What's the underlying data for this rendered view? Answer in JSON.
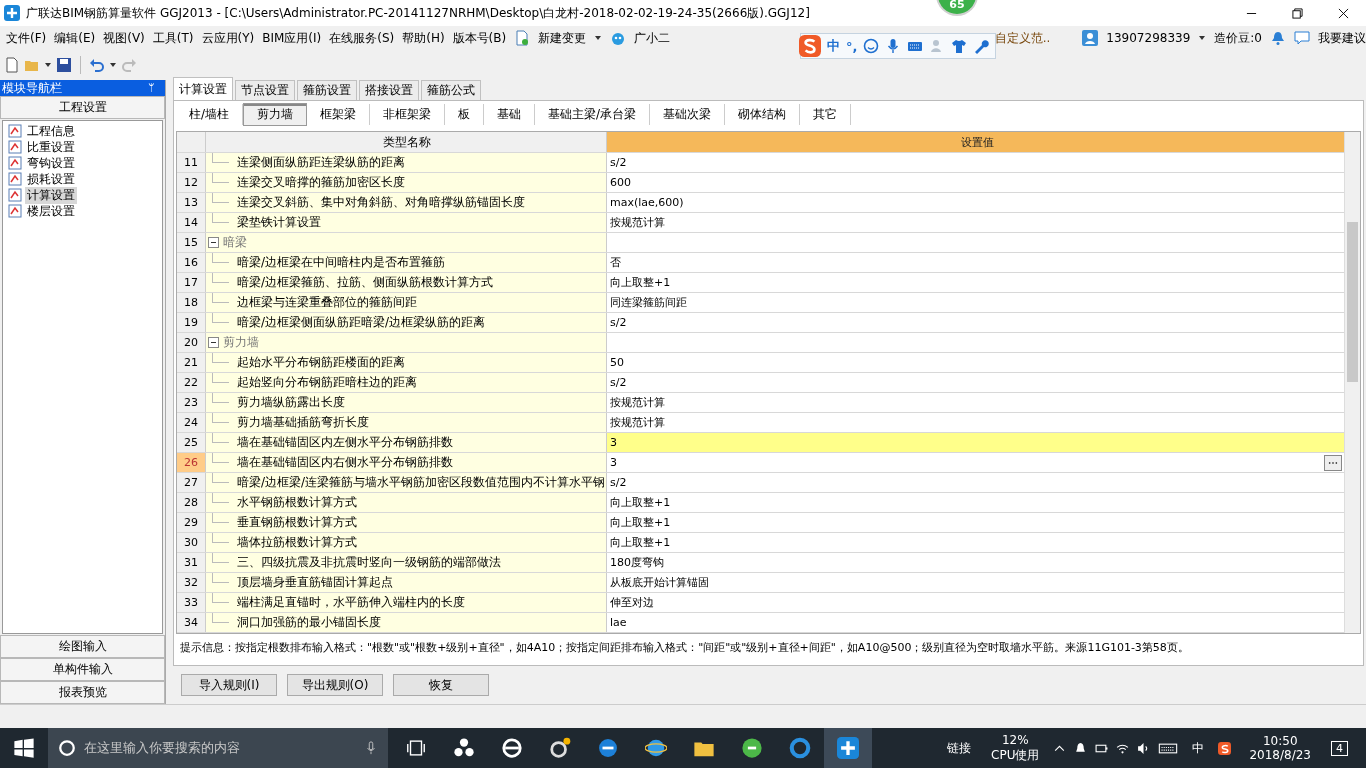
{
  "window": {
    "title": "广联达BIM钢筋算量软件 GGJ2013 - [C:\\Users\\Administrator.PC-20141127NRHM\\Desktop\\白龙村-2018-02-02-19-24-35(2666版).GGJ12]"
  },
  "badge": "65",
  "menu": [
    "文件(F)",
    "编辑(E)",
    "视图(V)",
    "工具(T)",
    "云应用(Y)",
    "BIM应用(I)",
    "在线服务(S)",
    "帮助(H)",
    "版本号(B)"
  ],
  "new_change": "新建变更",
  "assistant": "广小二",
  "tip_link": "自定义范..",
  "account": {
    "phone": "13907298339",
    "beans": "造价豆:0",
    "feedback": "我要建议"
  },
  "ime": {
    "mode": "中",
    "punct": "°,"
  },
  "sidebar": {
    "title": "模块导航栏",
    "pin": "ᛘ",
    "section": "工程设置",
    "items": [
      {
        "label": "工程信息",
        "selected": false
      },
      {
        "label": "比重设置",
        "selected": false
      },
      {
        "label": "弯钩设置",
        "selected": false
      },
      {
        "label": "损耗设置",
        "selected": false
      },
      {
        "label": "计算设置",
        "selected": true
      },
      {
        "label": "楼层设置",
        "selected": false
      }
    ],
    "bottom": [
      "绘图输入",
      "单构件输入",
      "报表预览"
    ]
  },
  "tabs": [
    {
      "label": "计算设置",
      "selected": true
    },
    {
      "label": "节点设置",
      "selected": false
    },
    {
      "label": "箍筋设置",
      "selected": false
    },
    {
      "label": "搭接设置",
      "selected": false
    },
    {
      "label": "箍筋公式",
      "selected": false
    }
  ],
  "subtabs": [
    {
      "label": "柱/墙柱",
      "selected": false
    },
    {
      "label": "剪力墙",
      "selected": true
    },
    {
      "label": "框架梁",
      "selected": false
    },
    {
      "label": "非框架梁",
      "selected": false
    },
    {
      "label": "板",
      "selected": false
    },
    {
      "label": "基础",
      "selected": false
    },
    {
      "label": "基础主梁/承台梁",
      "selected": false
    },
    {
      "label": "基础次梁",
      "selected": false
    },
    {
      "label": "砌体结构",
      "selected": false
    },
    {
      "label": "其它",
      "selected": false
    }
  ],
  "table": {
    "columns": [
      "类型名称",
      "设置值"
    ],
    "rows": [
      {
        "num": "11",
        "kind": "item",
        "name": "连梁侧面纵筋距连梁纵筋的距离",
        "value": "s/2",
        "selected": false,
        "highlight": false
      },
      {
        "num": "12",
        "kind": "item",
        "name": "连梁交叉暗撑的箍筋加密区长度",
        "value": "600",
        "selected": false,
        "highlight": false
      },
      {
        "num": "13",
        "kind": "item",
        "name": "连梁交叉斜筋、集中对角斜筋、对角暗撑纵筋锚固长度",
        "value": "max(lae,600)",
        "selected": false,
        "highlight": false
      },
      {
        "num": "14",
        "kind": "item",
        "name": "梁垫铁计算设置",
        "value": "按规范计算",
        "selected": false,
        "highlight": false
      },
      {
        "num": "15",
        "kind": "group",
        "name": "暗梁",
        "value": "",
        "expanded": true,
        "selected": false,
        "highlight": false
      },
      {
        "num": "16",
        "kind": "item",
        "name": "暗梁/边框梁在中间暗柱内是否布置箍筋",
        "value": "否",
        "selected": false,
        "highlight": false
      },
      {
        "num": "17",
        "kind": "item",
        "name": "暗梁/边框梁箍筋、拉筋、侧面纵筋根数计算方式",
        "value": "向上取整+1",
        "selected": false,
        "highlight": false
      },
      {
        "num": "18",
        "kind": "item",
        "name": "边框梁与连梁重叠部位的箍筋间距",
        "value": "同连梁箍筋间距",
        "selected": false,
        "highlight": false
      },
      {
        "num": "19",
        "kind": "item",
        "name": "暗梁/边框梁侧面纵筋距暗梁/边框梁纵筋的距离",
        "value": "s/2",
        "selected": false,
        "highlight": false
      },
      {
        "num": "20",
        "kind": "group",
        "name": "剪力墙",
        "value": "",
        "expanded": true,
        "selected": false,
        "highlight": false
      },
      {
        "num": "21",
        "kind": "item",
        "name": "起始水平分布钢筋距楼面的距离",
        "value": "50",
        "selected": false,
        "highlight": false
      },
      {
        "num": "22",
        "kind": "item",
        "name": "起始竖向分布钢筋距暗柱边的距离",
        "value": "s/2",
        "selected": false,
        "highlight": false
      },
      {
        "num": "23",
        "kind": "item",
        "name": "剪力墙纵筋露出长度",
        "value": "按规范计算",
        "selected": false,
        "highlight": false
      },
      {
        "num": "24",
        "kind": "item",
        "name": "剪力墙基础插筋弯折长度",
        "value": "按规范计算",
        "selected": false,
        "highlight": false
      },
      {
        "num": "25",
        "kind": "item",
        "name": "墙在基础锚固区内左侧水平分布钢筋排数",
        "value": "3",
        "selected": false,
        "highlight": true
      },
      {
        "num": "26",
        "kind": "item",
        "name": "墙在基础锚固区内右侧水平分布钢筋排数",
        "value": "3",
        "selected": true,
        "highlight": false
      },
      {
        "num": "27",
        "kind": "item",
        "name": "暗梁/边框梁/连梁箍筋与墙水平钢筋加密区段数值范围内不计算水平钢",
        "value": "s/2",
        "selected": false,
        "highlight": false
      },
      {
        "num": "28",
        "kind": "item",
        "name": "水平钢筋根数计算方式",
        "value": "向上取整+1",
        "selected": false,
        "highlight": false
      },
      {
        "num": "29",
        "kind": "item",
        "name": "垂直钢筋根数计算方式",
        "value": "向上取整+1",
        "selected": false,
        "highlight": false
      },
      {
        "num": "30",
        "kind": "item",
        "name": "墙体拉筋根数计算方式",
        "value": "向上取整+1",
        "selected": false,
        "highlight": false
      },
      {
        "num": "31",
        "kind": "item",
        "name": "三、四级抗震及非抗震时竖向一级钢筋的端部做法",
        "value": "180度弯钩",
        "selected": false,
        "highlight": false
      },
      {
        "num": "32",
        "kind": "item",
        "name": "顶层墙身垂直筋锚固计算起点",
        "value": "从板底开始计算锚固",
        "selected": false,
        "highlight": false
      },
      {
        "num": "33",
        "kind": "item",
        "name": "端柱满足直锚时，水平筋伸入端柱内的长度",
        "value": "伸至对边",
        "selected": false,
        "highlight": false
      },
      {
        "num": "34",
        "kind": "item",
        "name": "洞口加强筋的最小锚固长度",
        "value": "lae",
        "selected": false,
        "highlight": false
      }
    ]
  },
  "hint": "提示信息：按指定根数排布输入格式：\"根数\"或\"根数+级别+直径\"，如4A10；按指定间距排布输入格式：\"间距\"或\"级别+直径+间距\"，如A10@500；级别直径为空时取墙水平筋。来源11G101-3第58页。",
  "buttons": [
    "导入规则(I)",
    "导出规则(O)",
    "恢复"
  ],
  "taskbar": {
    "search_placeholder": "在这里输入你要搜索的内容",
    "link": "链接",
    "cpu_value": "12%",
    "cpu_label": "CPU使用",
    "ime": "中",
    "time": "10:50",
    "date": "2018/8/23",
    "notifications": "4"
  }
}
